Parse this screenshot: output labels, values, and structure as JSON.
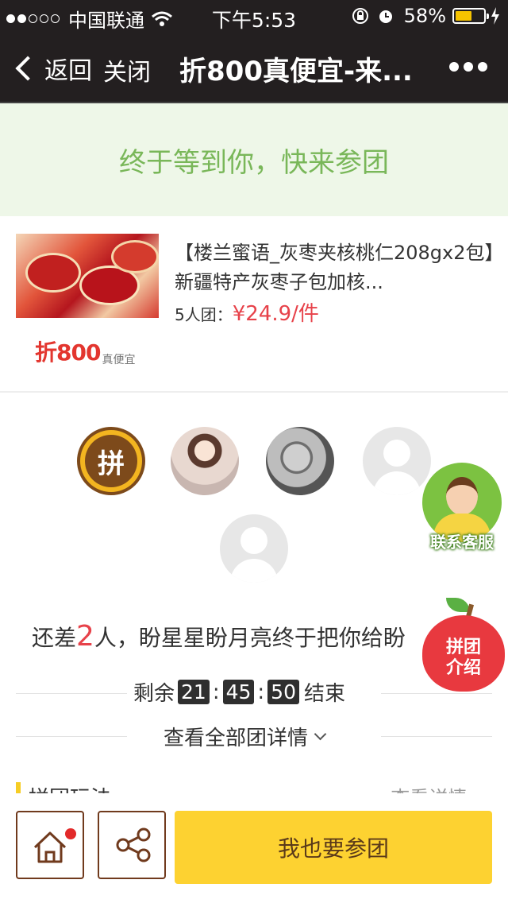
{
  "status_bar": {
    "carrier": "中国联通",
    "time": "下午5:53",
    "battery": "58%",
    "battery_level": 0.58
  },
  "nav": {
    "back_label": "返回",
    "close_label": "关闭",
    "title": "折800真便宜-来..."
  },
  "banner": {
    "text": "终于等到你，快来参团"
  },
  "product": {
    "title": "【楼兰蜜语_灰枣夹核桃仁208gx2包】新疆特产灰枣子包加核...",
    "group_size": "5人团：",
    "price": "¥24.9/件",
    "brand_main": "折800",
    "brand_sub": "真便宜"
  },
  "participants": {
    "leader_badge": "拼"
  },
  "floating": {
    "service_label": "联系客服",
    "intro_line1": "拼团",
    "intro_line2": "介绍"
  },
  "status": {
    "prefix": "还差",
    "count": "2",
    "suffix": "人，盼星星盼月亮终于把你给盼"
  },
  "countdown": {
    "label_before": "剩余",
    "hours": "21",
    "minutes": "45",
    "seconds": "50",
    "label_after": "结束"
  },
  "details_link": "查看全部团详情",
  "rules": {
    "title": "拼团玩法",
    "more": "查看详情 >"
  },
  "bottom": {
    "join_label": "我也要参团"
  },
  "colors": {
    "nav_bg": "#231f20",
    "banner_bg": "#eef7e8",
    "banner_text": "#79b759",
    "price": "#e7424a",
    "join_button": "#fdd231"
  }
}
